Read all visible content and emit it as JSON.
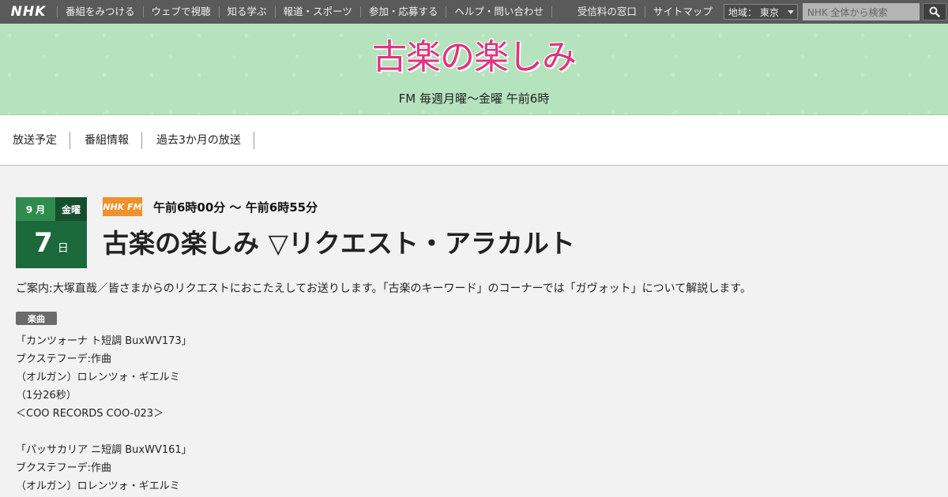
{
  "global_nav": {
    "logo": "NHK",
    "items": [
      {
        "label": "番組をみつける"
      },
      {
        "label": "ウェブで視聴"
      },
      {
        "label": "知る学ぶ"
      },
      {
        "label": "報道・スポーツ"
      },
      {
        "label": "参加・応募する"
      },
      {
        "label": "ヘルプ・問い合わせ"
      }
    ],
    "right_items": [
      {
        "label": "受信料の窓口"
      },
      {
        "label": "サイトマップ"
      }
    ],
    "region": {
      "label": "地域：",
      "value": "東京"
    },
    "search": {
      "placeholder": "NHK 全体から検索"
    }
  },
  "program": {
    "title": "古楽の楽しみ",
    "schedule": "FM 毎週月曜～金曜 午前6時"
  },
  "sub_nav": {
    "items": [
      {
        "label": "放送予定"
      },
      {
        "label": "番組情報"
      },
      {
        "label": "過去3か月の放送"
      }
    ]
  },
  "episode": {
    "date": {
      "month": "9 月",
      "dow": "金曜",
      "day": "7",
      "day_unit": "日"
    },
    "channel": "NHK FM",
    "air_time": "午前6時00分 ～ 午前6時55分",
    "title": "古楽の楽しみ ▽リクエスト・アラカルト",
    "description": "ご案内:大塚直哉／皆さまからのリクエストにおこたえしてお送りします。「古楽のキーワード」のコーナーでは「ガヴォット」について解説します。",
    "music_label": "楽曲",
    "tracks": [
      {
        "lines": [
          "「カンツォーナ ト短調 BuxWV173」",
          "ブクステフーデ:作曲",
          "（オルガン）ロレンツォ・ギエルミ",
          "（1分26秒）",
          "＜COO RECORDS COO-023＞"
        ]
      },
      {
        "lines": [
          "「パッサカリア ニ短調 BuxWV161」",
          "ブクステフーデ:作曲",
          "（オルガン）ロレンツォ・ギエルミ"
        ]
      }
    ]
  },
  "colors": {
    "topbar": "#5a5a5a",
    "banner": "#b4e3bd",
    "logo_pink": "#e0347f",
    "date_green": "#1c6a3c",
    "fm_orange": "#f0912b"
  }
}
